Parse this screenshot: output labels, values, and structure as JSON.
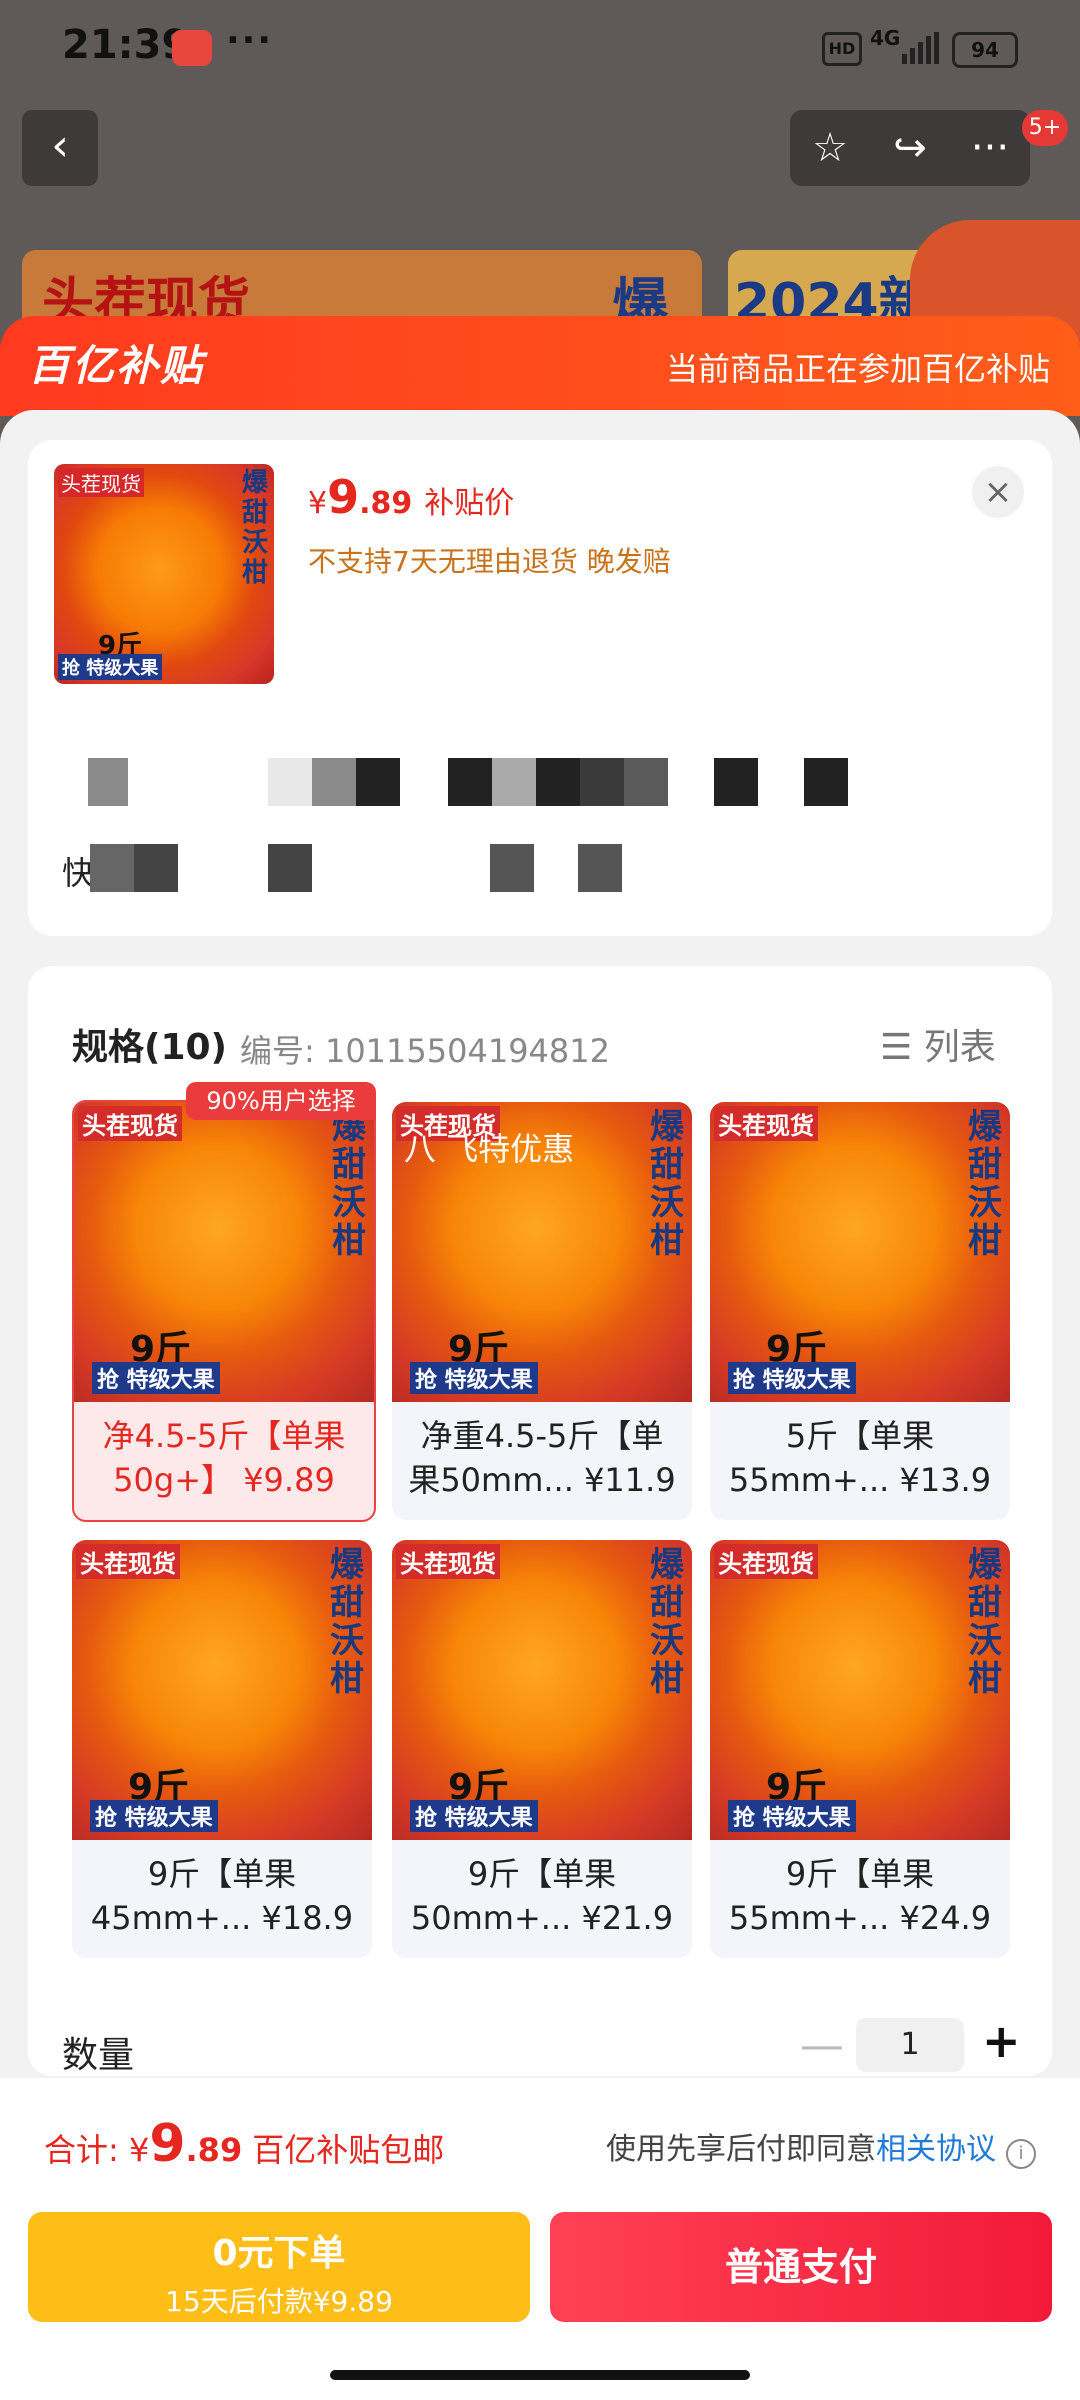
{
  "status_bar": {
    "time": "21:39",
    "more": "···",
    "hd": "HD",
    "network": "4G",
    "battery": "94"
  },
  "top_nav": {
    "back": "‹",
    "star": "☆",
    "share": "↪",
    "menu": "···",
    "badge": "5+"
  },
  "banners": {
    "b1": "头茬现货",
    "b1_right": "爆",
    "b2": "2024新"
  },
  "sheet": {
    "brand": "百亿补贴",
    "promo": "当前商品正在参加百亿补贴"
  },
  "product": {
    "thumb": {
      "tag": "头茬现货",
      "vertical": "爆甜沃柑",
      "weight": "9斤",
      "tag2": "抢 特级大果"
    },
    "price_currency": "¥",
    "price_int": "9",
    "price_dec": ".89",
    "price_label": "补贴价",
    "notes": "不支持7天无理由退货  晚发赔",
    "address_label": "快递发"
  },
  "specs": {
    "title": "规格(10)",
    "code": "编号: 10115504194812",
    "list_label": "列表",
    "selected_badge": "90%用户选择",
    "overlay_text": "八 飞特优惠",
    "items": [
      {
        "line1": "净4.5-5斤【单果",
        "line2": "50g+】 ¥9.89"
      },
      {
        "line1": "净重4.5-5斤【单",
        "line2": "果50mm... ¥11.9"
      },
      {
        "line1": "5斤【单果",
        "line2": "55mm+... ¥13.9"
      },
      {
        "line1": "9斤【单果",
        "line2": "45mm+... ¥18.9"
      },
      {
        "line1": "9斤【单果",
        "line2": "50mm+... ¥21.9"
      },
      {
        "line1": "9斤【单果",
        "line2": "55mm+... ¥24.9"
      }
    ]
  },
  "quantity": {
    "label": "数量",
    "minus": "—",
    "value": "1",
    "plus": "+"
  },
  "bottom": {
    "total_label": "合计: ",
    "currency": "¥",
    "int": "9",
    "dec": ".89",
    "tag": "百亿补贴包邮",
    "agree_text": "使用先享后付即同意",
    "agree_link": "相关协议",
    "info": "i",
    "zero_btn_title": "0元下单",
    "zero_btn_sub": "15天后付款¥9.89",
    "pay_btn": "普通支付"
  }
}
